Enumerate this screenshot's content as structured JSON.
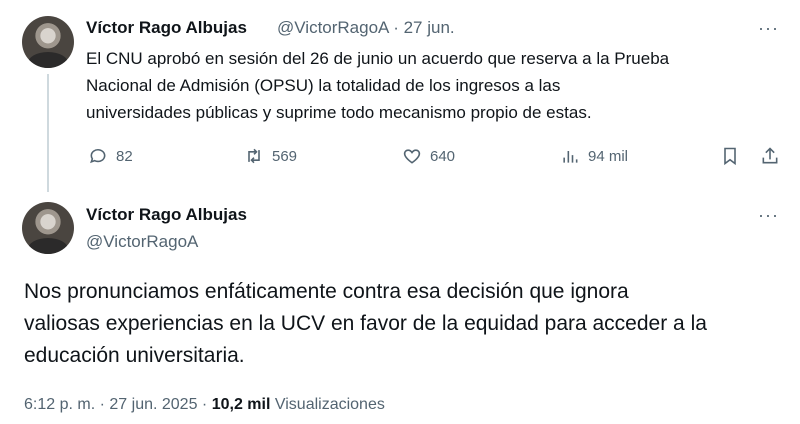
{
  "parent_tweet": {
    "author_name": "Víctor Rago Albujas",
    "author_handle": "@VictorRagoA",
    "separator": "·",
    "date": "27 jun.",
    "more": "···",
    "text_lines": [
      "El CNU aprobó en sesión del 26 de junio un acuerdo que reserva a la Prueba",
      "Nacional de Admisión (OPSU) la totalidad de los ingresos a las",
      "universidades públicas y suprime todo mecanismo propio de estas."
    ],
    "replies": "82",
    "reposts": "569",
    "likes": "640",
    "views": "94 mil"
  },
  "main_tweet": {
    "author_name": "Víctor Rago Albujas",
    "author_handle": "@VictorRagoA",
    "more": "···",
    "text_lines": [
      "Nos pronunciamos enfáticamente contra esa decisión que ignora",
      "valiosas experiencias en la UCV en favor de la equidad para acceder a la",
      "educación universitaria."
    ],
    "time": "6:12 p. m.",
    "separator1": "·",
    "date": "27 jun. 2025",
    "separator2": "·",
    "views_count": "10,2 mil",
    "views_label": "Visualizaciones"
  }
}
